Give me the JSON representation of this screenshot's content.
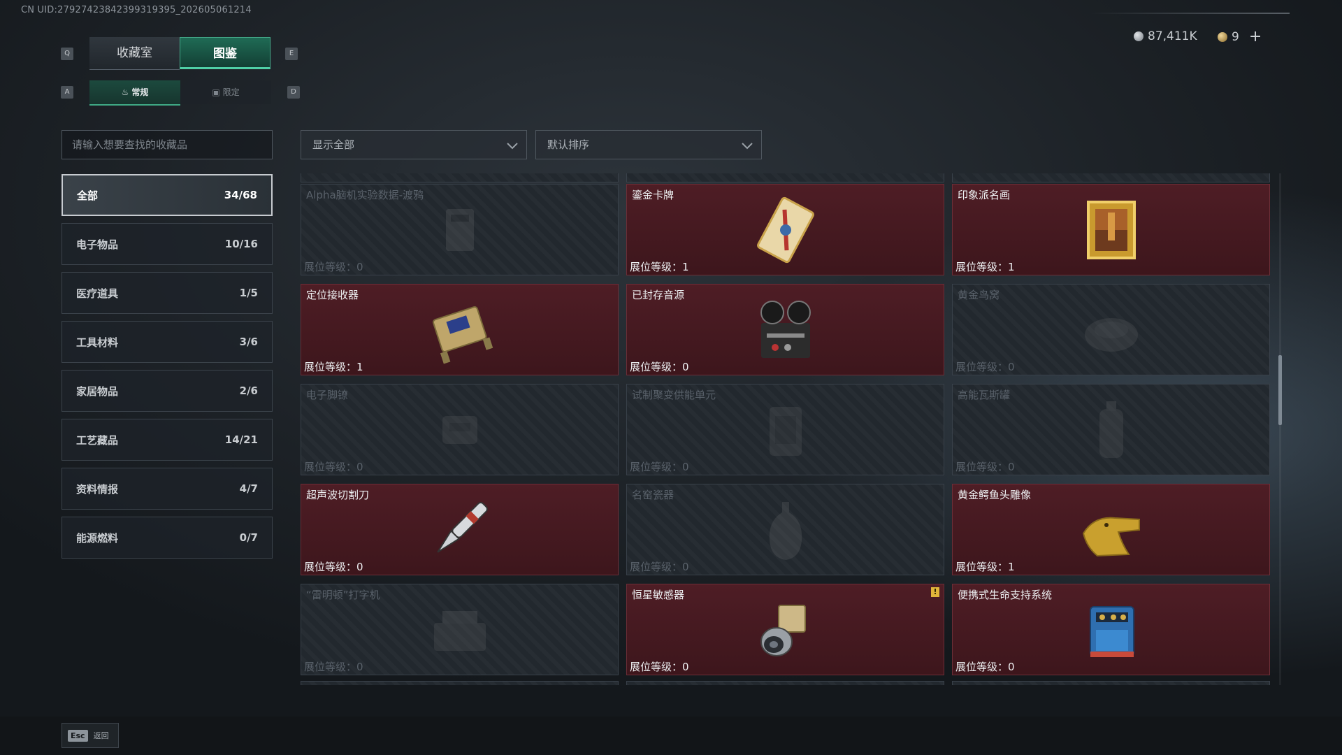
{
  "uid": "CN UID:2792742384239931939​5_202605061214",
  "currency": {
    "silver": "87,411K",
    "gold": "9",
    "add": "+"
  },
  "keys": {
    "tab_prev": "Q",
    "tab_next": "E",
    "sub_prev": "A",
    "sub_next": "D"
  },
  "tabs": [
    {
      "label": "收藏室"
    },
    {
      "label": "图鉴"
    }
  ],
  "subtabs": [
    {
      "label": "常规"
    },
    {
      "label": "限定"
    }
  ],
  "search": {
    "placeholder": "请输入想要查找的收藏品"
  },
  "filters": {
    "show": "显示全部",
    "sort": "默认排序"
  },
  "categories": [
    {
      "label": "全部",
      "count": "34/68"
    },
    {
      "label": "电子物品",
      "count": "10/16"
    },
    {
      "label": "医疗道具",
      "count": "1/5"
    },
    {
      "label": "工具材料",
      "count": "3/6"
    },
    {
      "label": "家居物品",
      "count": "2/6"
    },
    {
      "label": "工艺藏品",
      "count": "14/21"
    },
    {
      "label": "资料情报",
      "count": "4/7"
    },
    {
      "label": "能源燃料",
      "count": "0/7"
    }
  ],
  "items": [
    {
      "name": "Alpha脑机实验数据-渡鸦",
      "level": "展位等级：0",
      "owned": false,
      "icon": "data-module-icon"
    },
    {
      "name": "鎏金卡牌",
      "level": "展位等级：1",
      "owned": true,
      "icon": "gilded-card-icon"
    },
    {
      "name": "印象派名画",
      "level": "展位等级：1",
      "owned": true,
      "icon": "framed-painting-icon"
    },
    {
      "name": "定位接收器",
      "level": "展位等级：1",
      "owned": true,
      "icon": "locator-receiver-icon"
    },
    {
      "name": "已封存音源",
      "level": "展位等级：0",
      "owned": true,
      "icon": "reel-recorder-icon"
    },
    {
      "name": "黄金鸟窝",
      "level": "展位等级：0",
      "owned": false,
      "icon": "golden-nest-icon"
    },
    {
      "name": "电子脚镣",
      "level": "展位等级：0",
      "owned": false,
      "icon": "ankle-monitor-icon"
    },
    {
      "name": "试制聚变供能单元",
      "level": "展位等级：0",
      "owned": false,
      "icon": "fusion-cell-icon"
    },
    {
      "name": "高能瓦斯罐",
      "level": "展位等级：0",
      "owned": false,
      "icon": "gas-canister-icon"
    },
    {
      "name": "超声波切割刀",
      "level": "展位等级：0",
      "owned": true,
      "icon": "ultrasonic-knife-icon"
    },
    {
      "name": "名窑瓷器",
      "level": "展位等级：0",
      "owned": false,
      "icon": "porcelain-vase-icon"
    },
    {
      "name": "黄金鳄鱼头雕像",
      "level": "展位等级：1",
      "owned": true,
      "icon": "gold-crocodile-icon"
    },
    {
      "name": "“雷明顿”打字机",
      "level": "展位等级：0",
      "owned": false,
      "icon": "typewriter-icon"
    },
    {
      "name": "恒星敏感器",
      "level": "展位等级：0",
      "owned": true,
      "icon": "star-sensor-icon",
      "alert": "!"
    },
    {
      "name": "便携式生命支持系统",
      "level": "展位等级：0",
      "owned": true,
      "icon": "life-support-icon"
    }
  ],
  "footer": {
    "esc_key": "Esc",
    "esc_label": "返回"
  }
}
